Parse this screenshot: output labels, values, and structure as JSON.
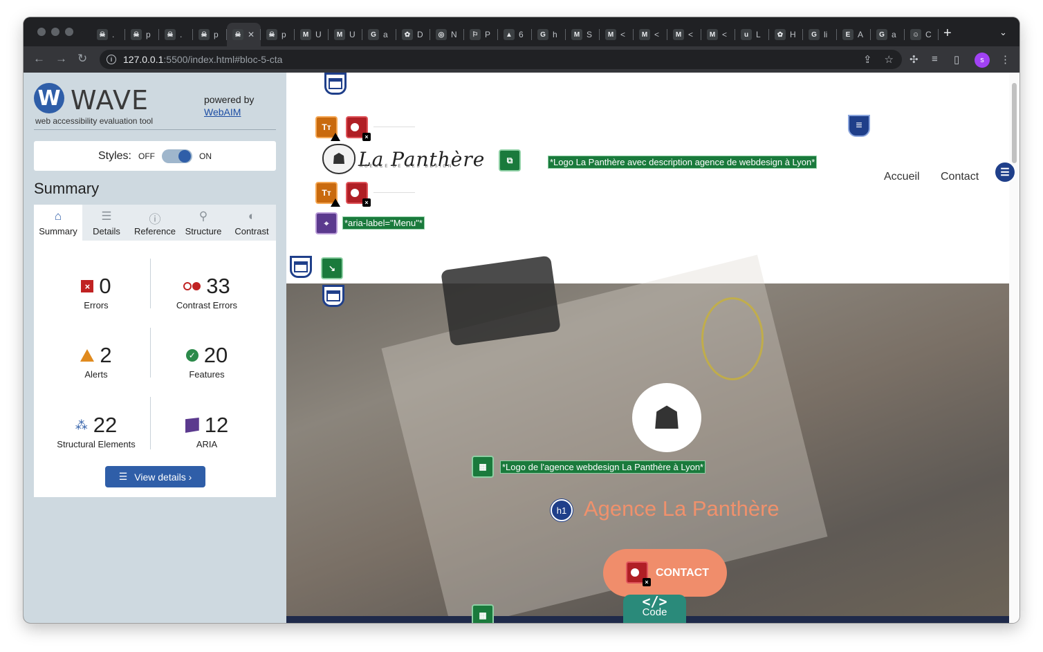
{
  "browser": {
    "url_host": "127.0.0.1",
    "url_rest": ":5500/index.html#bloc-5-cta",
    "tabs": [
      {
        "fav": "☠",
        "label": "."
      },
      {
        "fav": "☠",
        "label": "p"
      },
      {
        "fav": "☠",
        "label": "."
      },
      {
        "fav": "☠",
        "label": "p"
      },
      {
        "fav": "☠",
        "label": "✕",
        "active": true
      },
      {
        "fav": "☠",
        "label": "p"
      },
      {
        "fav": "M",
        "label": "U"
      },
      {
        "fav": "M",
        "label": "U"
      },
      {
        "fav": "G",
        "label": "a"
      },
      {
        "fav": "✿",
        "label": "D"
      },
      {
        "fav": "◎",
        "label": "N"
      },
      {
        "fav": "⚐",
        "label": "P"
      },
      {
        "fav": "▲",
        "label": "6"
      },
      {
        "fav": "G",
        "label": "h"
      },
      {
        "fav": "M",
        "label": "S"
      },
      {
        "fav": "M",
        "label": "<"
      },
      {
        "fav": "M",
        "label": "<"
      },
      {
        "fav": "M",
        "label": "<"
      },
      {
        "fav": "M",
        "label": "<"
      },
      {
        "fav": "u",
        "label": "L"
      },
      {
        "fav": "✿",
        "label": "H"
      },
      {
        "fav": "G",
        "label": "li"
      },
      {
        "fav": "E",
        "label": "A"
      },
      {
        "fav": "G",
        "label": "a"
      },
      {
        "fav": "☺",
        "label": "C"
      }
    ],
    "new_tab": "+",
    "profile_initial": "s"
  },
  "wave": {
    "logo_letter": "W",
    "name": "WAVE",
    "tagline": "web accessibility evaluation tool",
    "powered_by": "powered by",
    "webaim": "WebAIM",
    "styles_label": "Styles:",
    "styles_off": "OFF",
    "styles_on": "ON",
    "summary_title": "Summary",
    "tabs": [
      {
        "icon": "⌂",
        "label": "Summary"
      },
      {
        "icon": "☰",
        "label": "Details"
      },
      {
        "icon": "ⓘ",
        "label": "Reference"
      },
      {
        "icon": "⚲",
        "label": "Structure"
      },
      {
        "icon": "◐",
        "label": "Contrast"
      }
    ],
    "stats": {
      "errors": {
        "value": "0",
        "label": "Errors"
      },
      "contrast": {
        "value": "33",
        "label": "Contrast Errors"
      },
      "alerts": {
        "value": "2",
        "label": "Alerts"
      },
      "features": {
        "value": "20",
        "label": "Features"
      },
      "structural": {
        "value": "22",
        "label": "Structural Elements"
      },
      "aria": {
        "value": "12",
        "label": "ARIA"
      }
    },
    "view_details": "View details ›"
  },
  "page": {
    "brand": "La Panthère",
    "brand_sub": "AGENCE DE WEB DESIGN",
    "logo_alt_label": "*Logo La Panthère avec description agence de webdesign à Lyon*",
    "aria_label": "*aria-label=\"Menu\"*",
    "nav": [
      "Accueil",
      "Contact"
    ],
    "hero_alt_label": "*Logo de l'agence webdesign La Panthère à Lyon*",
    "h1_badge": "h1",
    "heading": "Agence La Panthère",
    "cta": "CONTACT",
    "code_tab": "Code",
    "code_glyph": "</>",
    "text_icon": "Tт"
  },
  "colors": {
    "wave_blue": "#2f5ea8",
    "error_red": "#c02222",
    "alert_orange": "#e08a1e",
    "feature_green": "#1a7a3c",
    "aria_purple": "#5b3a8e",
    "heading_salmon": "#f0916c"
  }
}
